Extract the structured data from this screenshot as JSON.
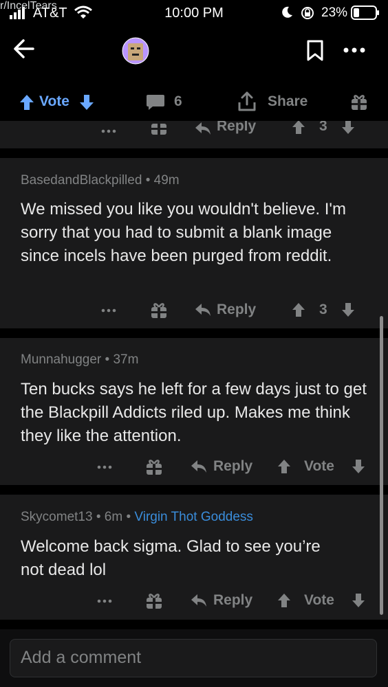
{
  "status_bar": {
    "carrier": "AT&T",
    "time": "10:00 PM",
    "battery": "23%"
  },
  "header": {
    "subreddit": "r/IncelTears"
  },
  "post_actions": {
    "vote_label": "Vote",
    "comment_count": "6",
    "share_label": "Share"
  },
  "partial_comment": {
    "reply_label": "Reply",
    "score": "3"
  },
  "comments": [
    {
      "author": "BasedandBlackpilled",
      "age": "49m",
      "body": "We missed you like you wouldn't believe.  I'm sorry that you had to submit a blank image since incels have been purged from reddit.",
      "reply_label": "Reply",
      "score": "3"
    },
    {
      "author": "Munnahugger",
      "age": "37m",
      "body": "Ten bucks says he left for a few days just to get the Blackpill Addicts riled up.  Makes me think they like the attention.",
      "reply_label": "Reply",
      "score": "Vote"
    },
    {
      "author": "Skycomet13",
      "age": "6m",
      "flair": "Virgin Thot Goddess",
      "body": "Welcome back sigma. Glad to see you’re not dead lol",
      "reply_label": "Reply",
      "score": "Vote"
    }
  ],
  "comment_input": {
    "placeholder": "Add a comment"
  },
  "colors": {
    "background": "#000000",
    "card": "#1a1a1b",
    "vote_accent": "#6aa8ff",
    "flair": "#3a8ddb",
    "muted": "#818384"
  },
  "icons": [
    "signal-icon",
    "wifi-icon",
    "moon-icon",
    "lock-rotation-icon",
    "battery-icon",
    "back-arrow-icon",
    "subreddit-avatar-icon",
    "bookmark-icon",
    "more-icon",
    "upvote-icon",
    "downvote-icon",
    "comment-icon",
    "share-icon",
    "award-icon",
    "reply-icon"
  ]
}
